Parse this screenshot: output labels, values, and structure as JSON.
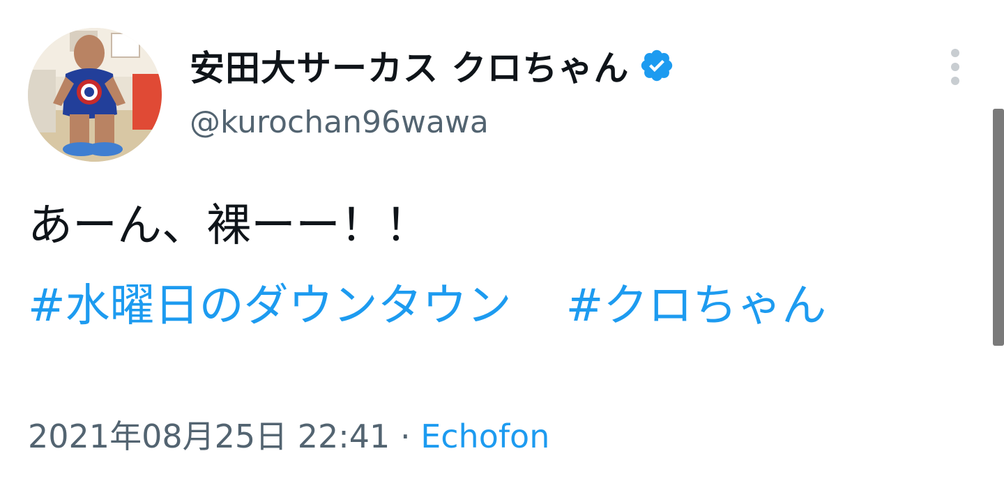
{
  "author": {
    "display_name": "安田大サーカス クロちゃん",
    "handle": "@kurochan96wawa",
    "verified": true
  },
  "tweet": {
    "text": "あーん、裸ーー！！",
    "hashtags": [
      "#水曜日のダウンタウン",
      "#クロちゃん"
    ],
    "timestamp": "2021年08月25日 22:41",
    "separator": "·",
    "source": "Echofon"
  },
  "icons": {
    "verified": "verified-badge-icon",
    "more": "more-vertical-icon"
  },
  "colors": {
    "link": "#1d9bf0",
    "text": "#0f1419",
    "secondary": "#536471",
    "verified": "#1d9bf0"
  }
}
